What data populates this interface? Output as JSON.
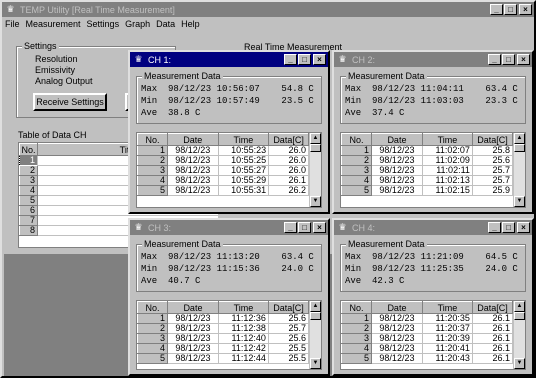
{
  "app": {
    "title": "TEMP Utility [Real Time Measurement]",
    "menu": [
      {
        "label": "File"
      },
      {
        "label": "Measurement"
      },
      {
        "label": "Settings"
      },
      {
        "label": "Graph"
      },
      {
        "label": "Data"
      },
      {
        "label": "Help"
      }
    ]
  },
  "settings": {
    "group_label": "Settings",
    "resolution_label": "Resolution",
    "emissivity_label": "Emissivity",
    "analog_output_label": "Analog Output",
    "receive_button": "Receive Settings"
  },
  "realtime": {
    "label": "Real Time Measurement"
  },
  "data_table": {
    "label": "Table of Data CH",
    "headers": [
      "No.",
      "Title"
    ],
    "rows": [
      "1",
      "2",
      "3",
      "4",
      "5",
      "6",
      "7",
      "8"
    ]
  },
  "channels": [
    {
      "title": "CH 1:",
      "group_label": "Measurement Data",
      "max_line": "Max  98/12/23 10:56:07    54.8 C",
      "min_line": "Min  98/12/23 10:57:49    23.5 C",
      "ave_line": "Ave  38.8 C",
      "headers": [
        "No.",
        "Date",
        "Time",
        "Data[C]"
      ],
      "rows": [
        {
          "no": "1",
          "date": "98/12/23",
          "time": "10:55:23",
          "val": "26.0"
        },
        {
          "no": "2",
          "date": "98/12/23",
          "time": "10:55:25",
          "val": "26.0"
        },
        {
          "no": "3",
          "date": "98/12/23",
          "time": "10:55:27",
          "val": "26.0"
        },
        {
          "no": "4",
          "date": "98/12/23",
          "time": "10:55:29",
          "val": "26.1"
        },
        {
          "no": "5",
          "date": "98/12/23",
          "time": "10:55:31",
          "val": "26.2"
        }
      ]
    },
    {
      "title": "CH 2:",
      "group_label": "Measurement Data",
      "max_line": "Max  98/12/23 11:04:11    63.4 C",
      "min_line": "Min  98/12/23 11:03:03    23.3 C",
      "ave_line": "Ave  37.4 C",
      "headers": [
        "No.",
        "Date",
        "Time",
        "Data[C]"
      ],
      "rows": [
        {
          "no": "1",
          "date": "98/12/23",
          "time": "11:02:07",
          "val": "25.8"
        },
        {
          "no": "2",
          "date": "98/12/23",
          "time": "11:02:09",
          "val": "25.6"
        },
        {
          "no": "3",
          "date": "98/12/23",
          "time": "11:02:11",
          "val": "25.7"
        },
        {
          "no": "4",
          "date": "98/12/23",
          "time": "11:02:13",
          "val": "25.7"
        },
        {
          "no": "5",
          "date": "98/12/23",
          "time": "11:02:15",
          "val": "25.9"
        }
      ]
    },
    {
      "title": "CH 3:",
      "group_label": "Measurement Data",
      "max_line": "Max  98/12/23 11:13:20    63.4 C",
      "min_line": "Min  98/12/23 11:15:36    24.0 C",
      "ave_line": "Ave  40.7 C",
      "headers": [
        "No.",
        "Date",
        "Time",
        "Data[C]"
      ],
      "rows": [
        {
          "no": "1",
          "date": "98/12/23",
          "time": "11:12:36",
          "val": "25.6"
        },
        {
          "no": "2",
          "date": "98/12/23",
          "time": "11:12:38",
          "val": "25.7"
        },
        {
          "no": "3",
          "date": "98/12/23",
          "time": "11:12:40",
          "val": "25.6"
        },
        {
          "no": "4",
          "date": "98/12/23",
          "time": "11:12:42",
          "val": "25.5"
        },
        {
          "no": "5",
          "date": "98/12/23",
          "time": "11:12:44",
          "val": "25.5"
        }
      ]
    },
    {
      "title": "CH 4:",
      "group_label": "Measurement Data",
      "max_line": "Max  98/12/23 11:21:09    64.5 C",
      "min_line": "Min  98/12/23 11:25:35    24.0 C",
      "ave_line": "Ave  42.3 C",
      "headers": [
        "No.",
        "Date",
        "Time",
        "Data[C]"
      ],
      "rows": [
        {
          "no": "1",
          "date": "98/12/23",
          "time": "11:20:35",
          "val": "26.1"
        },
        {
          "no": "2",
          "date": "98/12/23",
          "time": "11:20:37",
          "val": "26.1"
        },
        {
          "no": "3",
          "date": "98/12/23",
          "time": "11:20:39",
          "val": "26.1"
        },
        {
          "no": "4",
          "date": "98/12/23",
          "time": "11:20:41",
          "val": "26.1"
        },
        {
          "no": "5",
          "date": "98/12/23",
          "time": "11:20:43",
          "val": "26.1"
        }
      ]
    }
  ],
  "window_buttons": {
    "minimize": "_",
    "maximize": "□",
    "close": "×"
  },
  "scroll_arrows": {
    "up": "▲",
    "down": "▼"
  },
  "icons": {
    "thermometer": "thermometer-icon"
  }
}
